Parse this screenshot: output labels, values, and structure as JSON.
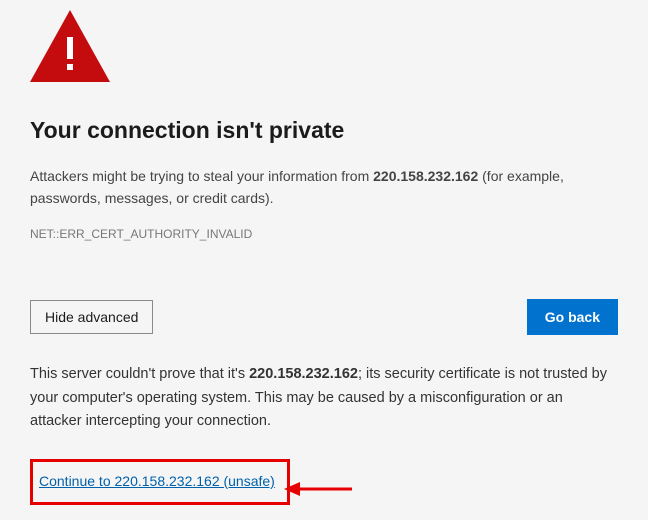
{
  "colors": {
    "warningIcon": "#c40c0f",
    "primaryButton": "#0173cf",
    "link": "#0061ab",
    "highlightBox": "#e60000",
    "annotationArrow": "#e60000"
  },
  "icon": "warning-triangle-exclamation",
  "heading": "Your connection isn't private",
  "warning": {
    "prefix": "Attackers might be trying to steal your information from ",
    "host": "220.158.232.162",
    "suffix": " (for example, passwords, messages, or credit cards)."
  },
  "errorCode": "NET::ERR_CERT_AUTHORITY_INVALID",
  "buttons": {
    "hideAdvanced": "Hide advanced",
    "goBack": "Go back"
  },
  "detail": {
    "prefix": "This server couldn't prove that it's ",
    "host": "220.158.232.162",
    "suffix": "; its security certificate is not trusted by your computer's operating system. This may be caused by a misconfiguration or an attacker intercepting your connection."
  },
  "proceedLink": "Continue to 220.158.232.162 (unsafe)"
}
